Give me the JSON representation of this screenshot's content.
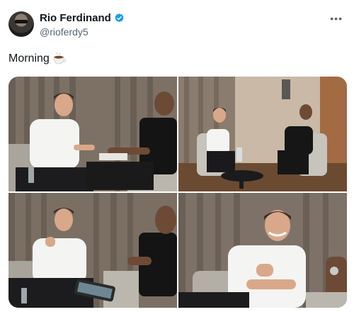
{
  "user": {
    "display_name": "Rio Ferdinand",
    "handle": "@rioferdy5",
    "verified": true,
    "verified_color": "#1d9bf0"
  },
  "tweet": {
    "text": "Morning",
    "emoji_icon": "coffee-cup-icon"
  },
  "menu": {
    "more_label": "•••"
  },
  "media": {
    "count": 4,
    "photo_icons": [
      "interview-photo",
      "interview-photo",
      "interview-photo",
      "interview-photo"
    ]
  }
}
